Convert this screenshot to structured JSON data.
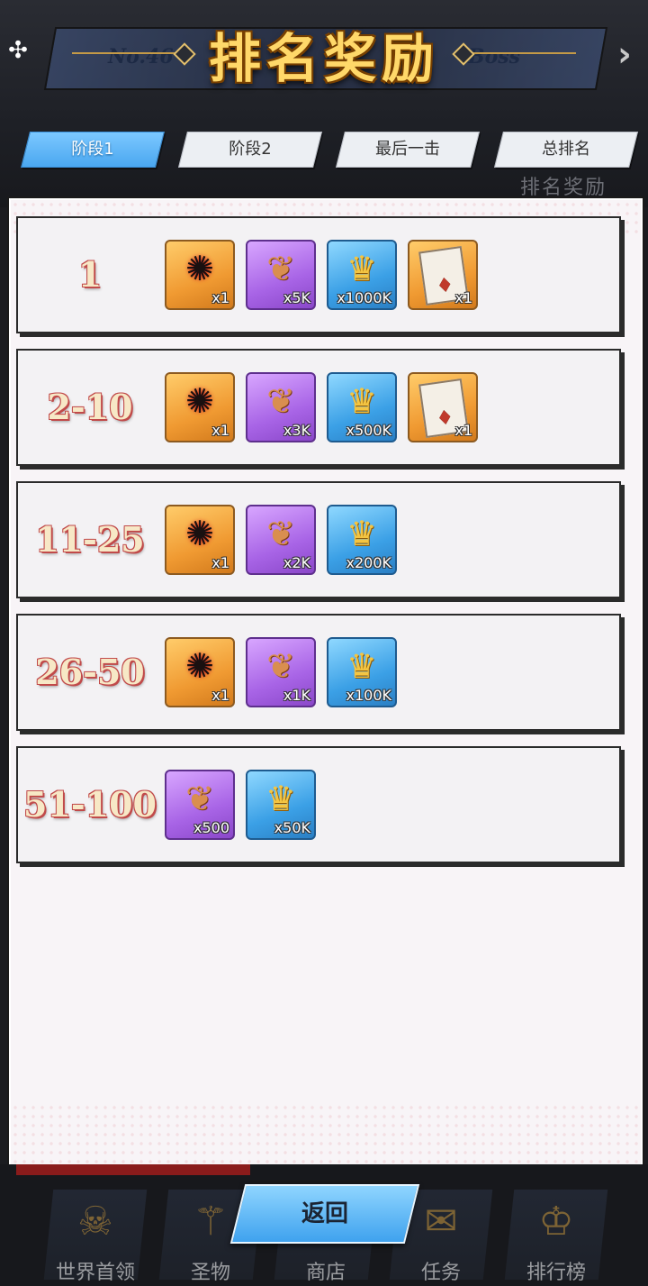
{
  "header": {
    "title": "排名奖励",
    "bg_left_text": "No.46",
    "bg_right_text": "Boss",
    "ghost_label": "排名奖励"
  },
  "tabs": [
    {
      "label": "阶段1",
      "active": true
    },
    {
      "label": "阶段2",
      "active": false
    },
    {
      "label": "最后一击",
      "active": false
    },
    {
      "label": "总排名",
      "active": false
    }
  ],
  "rows": [
    {
      "rank": "1",
      "items": [
        {
          "type": "dark-emblem",
          "color": "orange",
          "count": "x1"
        },
        {
          "type": "claw",
          "color": "purple",
          "count": "x5K"
        },
        {
          "type": "coin",
          "color": "blue",
          "count": "x1000K"
        },
        {
          "type": "card",
          "color": "orange",
          "count": "x1"
        }
      ]
    },
    {
      "rank": "2-10",
      "items": [
        {
          "type": "dark-emblem",
          "color": "orange",
          "count": "x1"
        },
        {
          "type": "claw",
          "color": "purple",
          "count": "x3K"
        },
        {
          "type": "coin",
          "color": "blue",
          "count": "x500K"
        },
        {
          "type": "card",
          "color": "orange",
          "count": "x1"
        }
      ]
    },
    {
      "rank": "11-25",
      "items": [
        {
          "type": "dark-emblem",
          "color": "orange",
          "count": "x1"
        },
        {
          "type": "claw",
          "color": "purple",
          "count": "x2K"
        },
        {
          "type": "coin",
          "color": "blue",
          "count": "x200K"
        }
      ]
    },
    {
      "rank": "26-50",
      "items": [
        {
          "type": "dark-emblem",
          "color": "orange",
          "count": "x1"
        },
        {
          "type": "claw",
          "color": "purple",
          "count": "x1K"
        },
        {
          "type": "coin",
          "color": "blue",
          "count": "x100K"
        }
      ]
    },
    {
      "rank": "51-100",
      "items": [
        {
          "type": "claw",
          "color": "purple",
          "count": "x500"
        },
        {
          "type": "coin",
          "color": "blue",
          "count": "x50K"
        }
      ]
    }
  ],
  "back_button": {
    "label": "返回"
  },
  "bottom_nav": [
    {
      "label": "世界首领",
      "icon": "demon-mask-icon"
    },
    {
      "label": "圣物",
      "icon": "staff-icon"
    },
    {
      "label": "商店",
      "icon": "shop-icon"
    },
    {
      "label": "任务",
      "icon": "scroll-icon"
    },
    {
      "label": "排行榜",
      "icon": "trophy-icon"
    }
  ],
  "colors": {
    "tab_active": "#4aa7f0",
    "title_gold": "#ffd869",
    "rank_outline": "#c14a4a"
  }
}
